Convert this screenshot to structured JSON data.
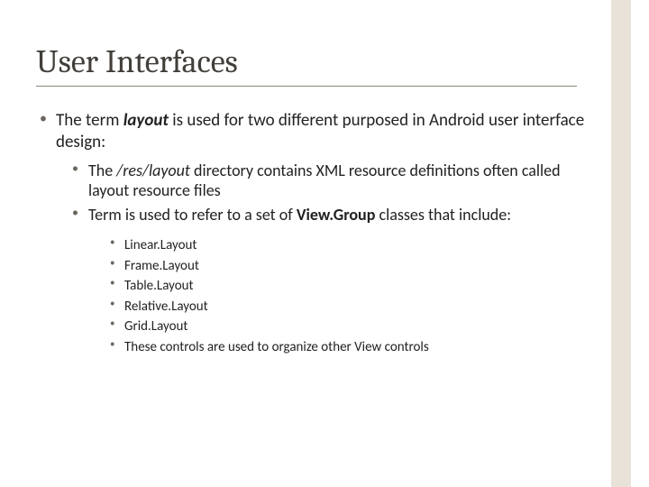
{
  "title": "User Interfaces",
  "bullets": {
    "l1": {
      "a1": "The term ",
      "a2": "layout",
      "a3": " is used for two different purposed in Android user interface design:"
    },
    "l2": {
      "a1": "The ",
      "a2": "/res/layout",
      "a3": " directory contains XML resource definitions often called layout resource files",
      "b1": "Term is used to refer to a set of ",
      "b2": "View.Group",
      "b3": " classes that include:"
    },
    "l3": {
      "a": "Linear.Layout",
      "b": "Frame.Layout",
      "c": "Table.Layout",
      "d": "Relative.Layout",
      "e": "Grid.Layout",
      "f": "These controls are used to organize other View controls"
    }
  }
}
